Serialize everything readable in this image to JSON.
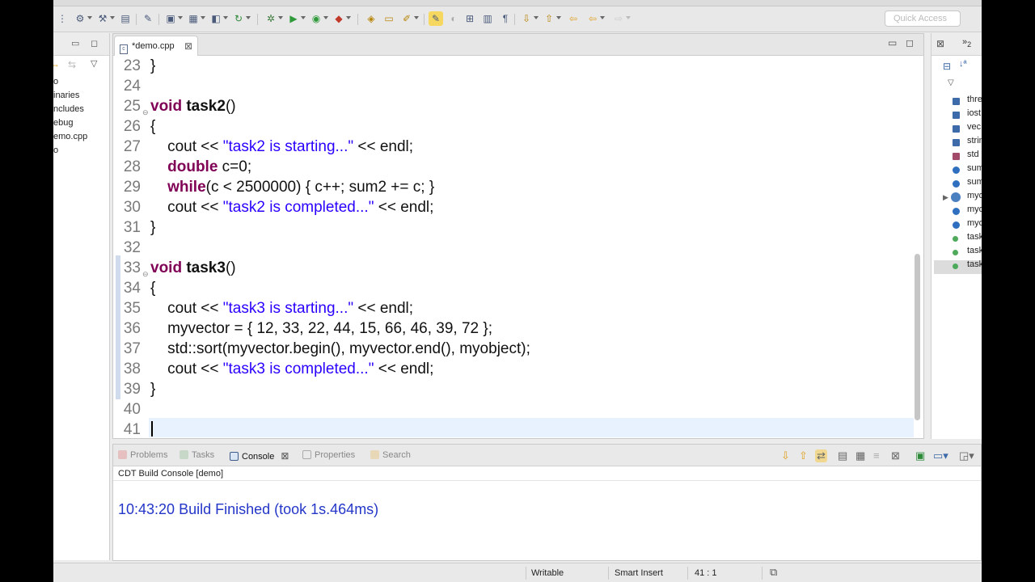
{
  "toolbar": {
    "quick_access_placeholder": "Quick Access"
  },
  "project_explorer": {
    "items": [
      "o",
      "inaries",
      "ncludes",
      "ebug",
      "emo.cpp",
      "o"
    ]
  },
  "editor": {
    "tab_label": "*demo.cpp",
    "lines": [
      {
        "n": "23",
        "text": "}"
      },
      {
        "n": "24",
        "text": ""
      },
      {
        "n": "25",
        "kw": "void",
        "fn": "task2",
        "rest": "()"
      },
      {
        "n": "26",
        "text": "{"
      },
      {
        "n": "27",
        "pre": "    cout << ",
        "str": "\"task2 is starting...\"",
        "post": " << endl;"
      },
      {
        "n": "28",
        "pre": "    ",
        "kw": "double",
        "rest": " c=0;"
      },
      {
        "n": "29",
        "pre": "    ",
        "kw": "while",
        "rest": "(c < 2500000) { c++; sum2 += c; }"
      },
      {
        "n": "30",
        "pre": "    cout << ",
        "str": "\"task2 is completed...\"",
        "post": " << endl;"
      },
      {
        "n": "31",
        "text": "}"
      },
      {
        "n": "32",
        "text": ""
      },
      {
        "n": "33",
        "kw": "void",
        "fn": "task3",
        "rest": "()"
      },
      {
        "n": "34",
        "text": "{"
      },
      {
        "n": "35",
        "pre": "    cout << ",
        "str": "\"task3 is starting...\"",
        "post": " << endl;"
      },
      {
        "n": "36",
        "text": "    myvector = { 12, 33, 22, 44, 15, 66, 46, 39, 72 };"
      },
      {
        "n": "37",
        "text": "    std::sort(myvector.begin(), myvector.end(), myobject);"
      },
      {
        "n": "38",
        "pre": "    cout << ",
        "str": "\"task3 is completed...\"",
        "post": " << endl;"
      },
      {
        "n": "39",
        "text": "}"
      },
      {
        "n": "40",
        "text": ""
      },
      {
        "n": "41",
        "text": ""
      }
    ]
  },
  "outline": {
    "header_label": "2",
    "items": [
      {
        "label": "thre",
        "kind": "inc"
      },
      {
        "label": "iost",
        "kind": "inc"
      },
      {
        "label": "vec",
        "kind": "inc"
      },
      {
        "label": "strin",
        "kind": "inc"
      },
      {
        "label": "std",
        "kind": "ns"
      },
      {
        "label": "sum",
        "kind": "var"
      },
      {
        "label": "sum",
        "kind": "var"
      },
      {
        "label": "myo",
        "kind": "cls"
      },
      {
        "label": "myo",
        "kind": "var"
      },
      {
        "label": "myo",
        "kind": "var"
      },
      {
        "label": "task",
        "kind": "fnc"
      },
      {
        "label": "task",
        "kind": "fnc"
      },
      {
        "label": "task",
        "kind": "fnc"
      }
    ]
  },
  "console": {
    "tabs": [
      "Problems",
      "Tasks",
      "Console",
      "Properties",
      "Search"
    ],
    "active_tab": "Console",
    "title": "CDT Build Console [demo]",
    "output": "10:43:20 Build Finished (took 1s.464ms)"
  },
  "statusbar": {
    "writable": "Writable",
    "insert_mode": "Smart Insert",
    "position": "41 : 1"
  },
  "colors": {
    "keyword": "#7f0055",
    "string": "#2a00ff",
    "console_text": "#2436c8",
    "current_line": "#e8f2fe"
  }
}
